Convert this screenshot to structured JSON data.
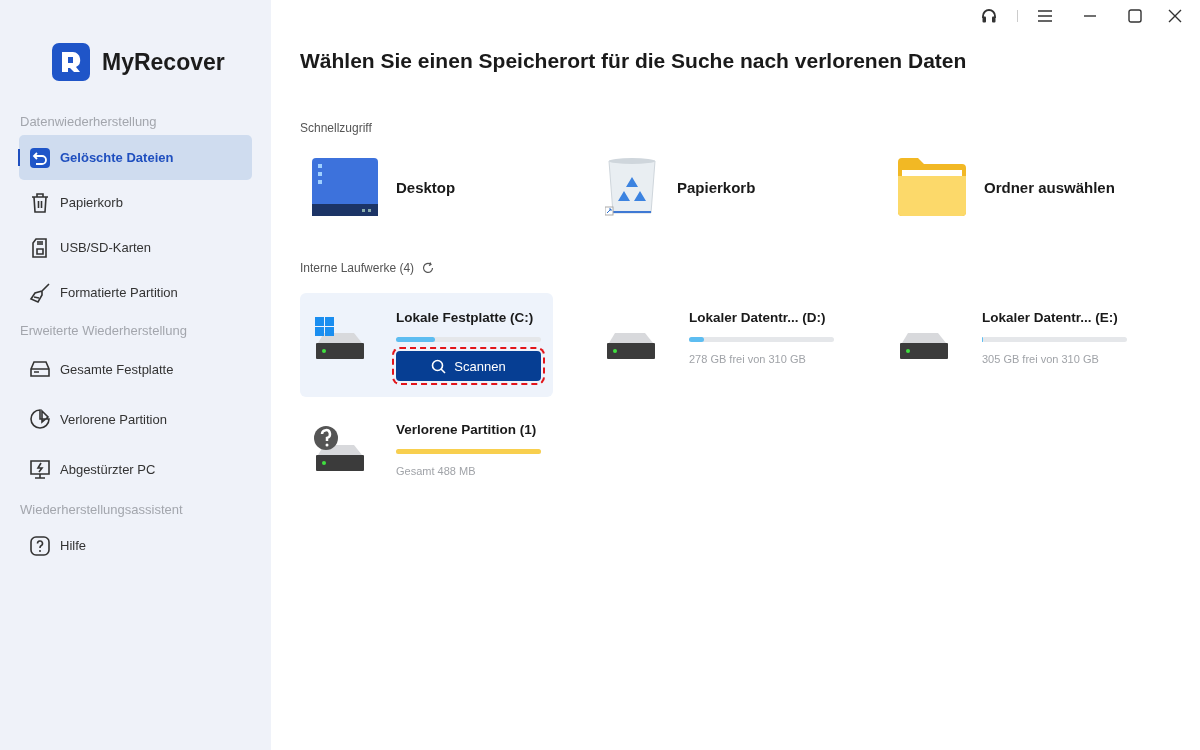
{
  "app": {
    "name": "MyRecover"
  },
  "sidebar": {
    "sections": [
      {
        "heading": "Datenwiederherstellung",
        "items": [
          {
            "label": "Gelöschte Dateien",
            "selected": true
          },
          {
            "label": "Papierkorb",
            "selected": false
          },
          {
            "label": "USB/SD-Karten",
            "selected": false
          },
          {
            "label": "Formatierte Partition",
            "selected": false
          }
        ]
      },
      {
        "heading": "Erweiterte Wiederherstellung",
        "items": [
          {
            "label": "Gesamte Festplatte",
            "selected": false
          },
          {
            "label": "Verlorene Partition",
            "selected": false
          },
          {
            "label": "Abgestürzter PC",
            "selected": false
          }
        ]
      },
      {
        "heading": "Wiederherstellungsassistent",
        "items": [
          {
            "label": "Hilfe",
            "selected": false
          }
        ]
      }
    ]
  },
  "title": "Wählen Sie einen Speicherort für die Suche nach verlorenen Daten",
  "quick_access": {
    "heading": "Schnellzugriff",
    "items": [
      {
        "kind": "desktop",
        "label": "Desktop"
      },
      {
        "kind": "recycle",
        "label": "Papierkorb"
      },
      {
        "kind": "folder",
        "label": "Ordner auswählen"
      }
    ]
  },
  "drives": {
    "heading": "Interne Laufwerke (4)",
    "items": [
      {
        "kind": "system",
        "name": "Lokale Festplatte (C:)",
        "level": 0.27,
        "selected": true,
        "button": "Scannen"
      },
      {
        "kind": "data",
        "name": "Lokaler Datentr... (D:)",
        "level": 0.1,
        "selected": false,
        "info": "278 GB frei von 310 GB"
      },
      {
        "kind": "data",
        "name": "Lokaler Datentr... (E:)",
        "level": 0.01,
        "selected": false,
        "info": "305 GB frei von 310 GB"
      },
      {
        "kind": "lost",
        "name": "Verlorene Partition (1)",
        "level": 1,
        "selected": false,
        "info": "Gesamt 488 MB"
      }
    ]
  }
}
